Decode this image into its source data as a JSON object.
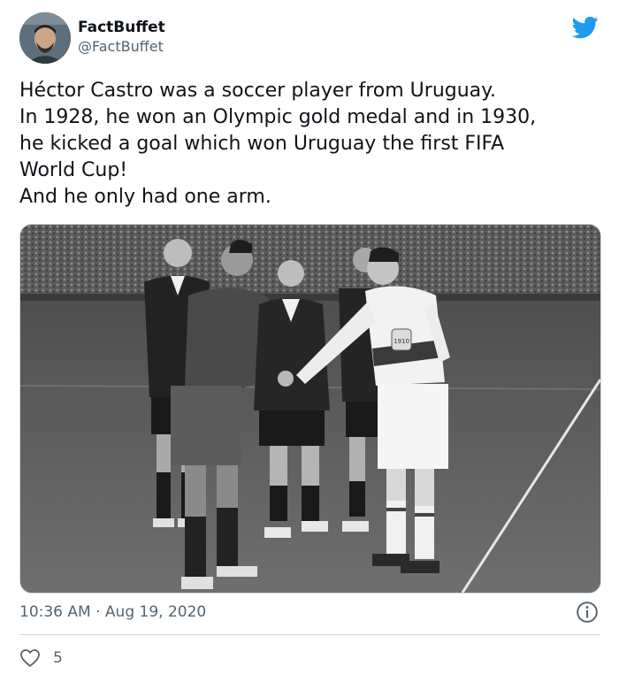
{
  "author": {
    "display_name": "FactBuffet",
    "handle": "@FactBuffet",
    "avatar_icon": "profile-avatar"
  },
  "brand": {
    "icon": "twitter-bird-icon",
    "color": "#1d9bf0"
  },
  "tweet": {
    "lines": [
      "Héctor Castro was a soccer player from Uruguay.",
      "In 1928, he won an Olympic gold medal and in 1930,",
      "he kicked a goal which won Uruguay the first FIFA",
      "World Cup!",
      "And he only had one arm."
    ]
  },
  "media": {
    "kind": "black-and-white photograph of five men on a soccer pitch, two players shaking hands",
    "jersey_badge": "1910"
  },
  "meta": {
    "time": "10:36 AM",
    "separator": "·",
    "date": "Aug 19, 2020",
    "info_icon": "info-icon"
  },
  "engagement": {
    "like_icon": "heart-icon",
    "like_count": "5"
  },
  "colors": {
    "text_primary": "#0f1419",
    "text_secondary": "#536471",
    "divider": "#cfd9de"
  }
}
